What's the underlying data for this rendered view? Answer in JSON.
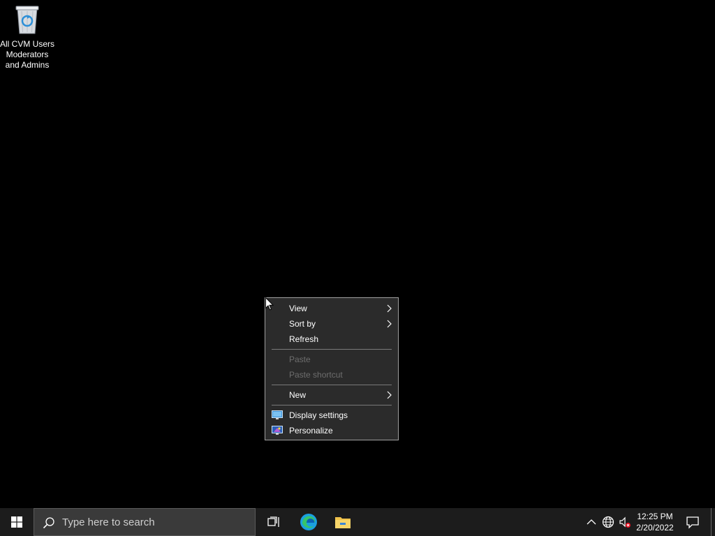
{
  "desktop": {
    "icons": [
      {
        "label": "All CVM Users\nModerators\nand Admins",
        "icon": "recycle-bin-icon"
      }
    ]
  },
  "context_menu": {
    "items": [
      {
        "label": "View",
        "submenu": true,
        "enabled": true
      },
      {
        "label": "Sort by",
        "submenu": true,
        "enabled": true
      },
      {
        "label": "Refresh",
        "submenu": false,
        "enabled": true
      },
      {
        "label": "Paste",
        "submenu": false,
        "enabled": false
      },
      {
        "label": "Paste shortcut",
        "submenu": false,
        "enabled": false
      },
      {
        "label": "New",
        "submenu": true,
        "enabled": true
      },
      {
        "label": "Display settings",
        "submenu": false,
        "enabled": true,
        "icon": "display-settings-icon"
      },
      {
        "label": "Personalize",
        "submenu": false,
        "enabled": true,
        "icon": "personalize-icon"
      }
    ]
  },
  "taskbar": {
    "search_placeholder": "Type here to search",
    "pinned": [
      "task-view-icon",
      "edge-icon",
      "file-explorer-icon"
    ],
    "tray": [
      "chevron-up-icon",
      "network-icon",
      "volume-muted-icon"
    ],
    "clock_time": "12:25 PM",
    "clock_date": "2/20/2022"
  },
  "colors": {
    "taskbar_bg": "#1c1c1c",
    "menu_bg": "#2b2b2b",
    "menu_disabled_text": "#6d6d6d",
    "folder_yellow": "#f0c24b",
    "edge_blue": "#1aa0e0"
  }
}
